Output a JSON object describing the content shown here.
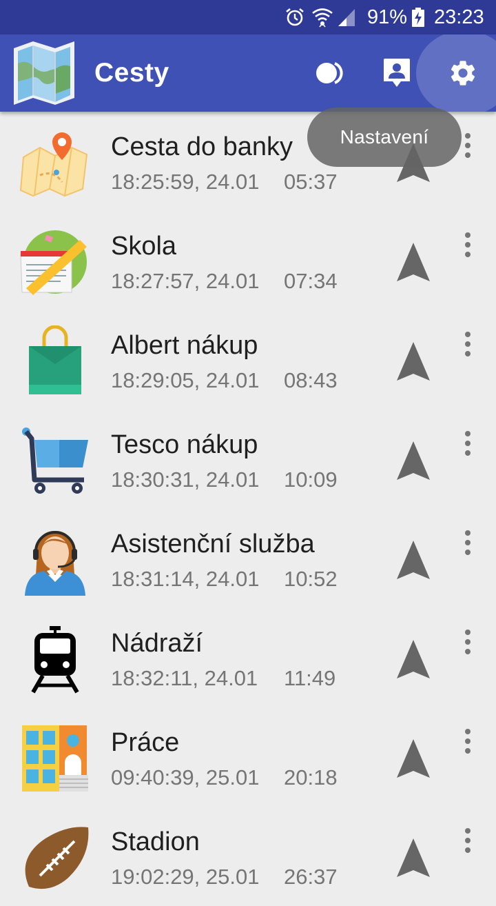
{
  "status_bar": {
    "icons": [
      "alarm-icon",
      "wifi-icon",
      "signal-icon",
      "battery-charging-icon"
    ],
    "battery": "91%",
    "time": "23:23"
  },
  "app_bar": {
    "title": "Cesty",
    "actions": [
      "night-mode-icon",
      "contact-icon",
      "settings-icon"
    ]
  },
  "tooltip": {
    "text": "Nastavení"
  },
  "routes": [
    {
      "name": "Cesta do banky",
      "datetime": "18:25:59, 24.01",
      "duration": "05:37",
      "icon": "map-pin-icon"
    },
    {
      "name": "Skola",
      "datetime": "18:27:57, 24.01",
      "duration": "07:34",
      "icon": "school-icon"
    },
    {
      "name": "Albert nákup",
      "datetime": "18:29:05, 24.01",
      "duration": "08:43",
      "icon": "shopping-bag-icon"
    },
    {
      "name": "Tesco nákup",
      "datetime": "18:30:31, 24.01",
      "duration": "10:09",
      "icon": "shopping-cart-icon"
    },
    {
      "name": "Asistenční služba",
      "datetime": "18:31:14, 24.01",
      "duration": "10:52",
      "icon": "support-agent-icon"
    },
    {
      "name": "Nádraží",
      "datetime": "18:32:11, 24.01",
      "duration": "11:49",
      "icon": "train-icon"
    },
    {
      "name": "Práce",
      "datetime": "09:40:39, 25.01",
      "duration": "20:18",
      "icon": "office-building-icon"
    },
    {
      "name": "Stadion",
      "datetime": "19:02:29, 25.01",
      "duration": "26:37",
      "icon": "football-icon"
    }
  ],
  "colors": {
    "status_bar": "#2f3a97",
    "app_bar": "#3f51b5",
    "background": "#ededed",
    "secondary_text": "#757575",
    "navigate_icon": "#666666"
  }
}
